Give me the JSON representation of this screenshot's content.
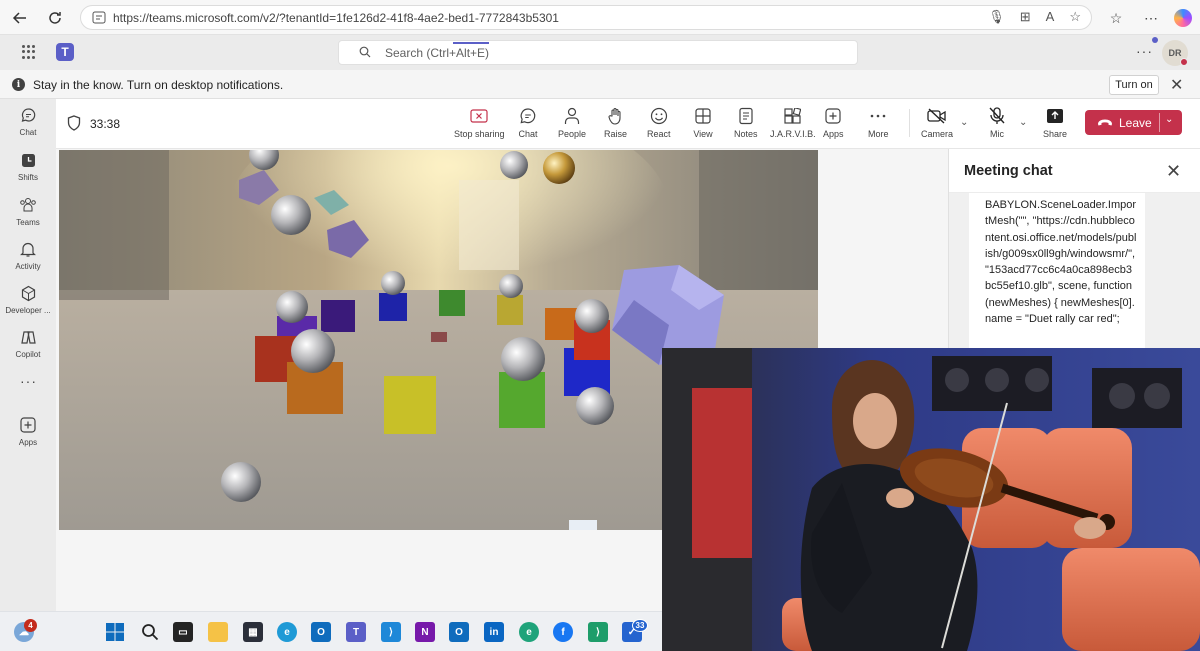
{
  "browser": {
    "url": "https://teams.microsoft.com/v2/?tenantId=1fe126d2-41f8-4ae2-bed1-7772843b5301"
  },
  "teams_bar": {
    "search_placeholder": "Search (Ctrl+Alt+E)",
    "avatar_initials": "DR"
  },
  "notification": {
    "text": "Stay in the know. Turn on desktop notifications.",
    "button": "Turn on"
  },
  "rail": {
    "items": [
      {
        "label": "Chat",
        "icon": "chat-icon"
      },
      {
        "label": "Shifts",
        "icon": "shifts-icon"
      },
      {
        "label": "Teams",
        "icon": "teams-icon"
      },
      {
        "label": "Activity",
        "icon": "bell-icon"
      },
      {
        "label": "Developer ...",
        "icon": "developer-icon"
      },
      {
        "label": "Copilot",
        "icon": "copilot-icon"
      },
      {
        "label": "Apps",
        "icon": "plus-icon"
      }
    ]
  },
  "meeting": {
    "timer": "33:38",
    "toolbar": {
      "stop_sharing": "Stop sharing",
      "chat": "Chat",
      "people": "People",
      "raise": "Raise",
      "react": "React",
      "view": "View",
      "notes": "Notes",
      "jarvis": "J.A.R.V.I.B.",
      "apps": "Apps",
      "more": "More",
      "camera": "Camera",
      "mic": "Mic",
      "share": "Share",
      "leave": "Leave"
    }
  },
  "chat_panel": {
    "title": "Meeting chat",
    "message": "BABYLON.SceneLoader.ImportMesh(\"\", \"https://cdn.hubblecontent.osi.office.net/models/publish/g009sx0ll9gh/windowsmr/\", \"153acd77cc6c4a0ca898ecb3bc55ef10.glb\", scene, function (newMeshes) { newMeshes[0].name = \"Duet rally car red\";"
  },
  "taskbar": {
    "weather_badge": "4",
    "todo_badge": "33"
  },
  "colors": {
    "teams_purple": "#5b5fc7",
    "leave_red": "#c4314b"
  }
}
